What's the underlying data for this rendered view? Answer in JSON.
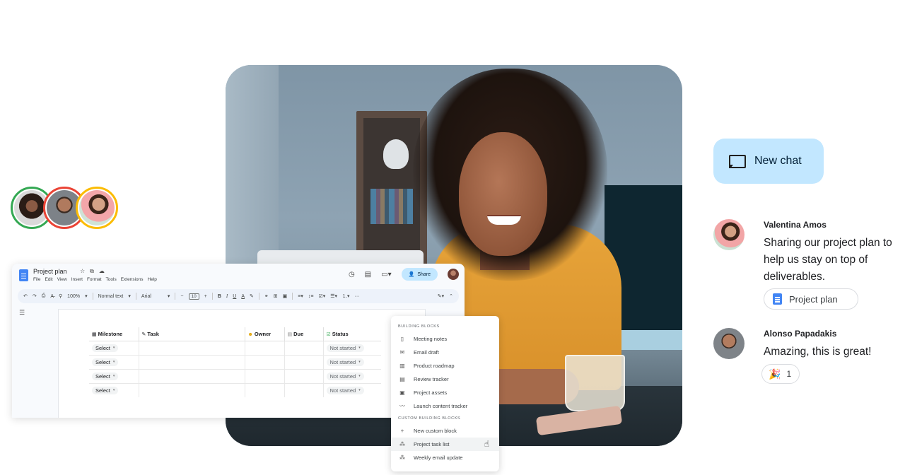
{
  "avatars": [
    {
      "name": "collaborator-1",
      "ring_color": "#34a853"
    },
    {
      "name": "collaborator-2",
      "ring_color": "#ea4335"
    },
    {
      "name": "collaborator-3",
      "ring_color": "#fbbc04"
    }
  ],
  "docs": {
    "title": "Project plan",
    "title_icons": [
      "☆",
      "⧉",
      "☁"
    ],
    "menu": [
      "File",
      "Edit",
      "View",
      "Insert",
      "Format",
      "Tools",
      "Extensions",
      "Help"
    ],
    "share_label": "Share",
    "header_icons": {
      "history": "◷",
      "comments": "▤",
      "meet": "▭▾"
    },
    "toolbar": {
      "undo": "↶",
      "redo": "↷",
      "print": "⎙",
      "spellcheck": "A̶",
      "paint_format": "⚲",
      "zoom": "100%",
      "style": "Normal text",
      "font": "Arial",
      "font_size": "10",
      "minus": "−",
      "plus": "+",
      "bold": "B",
      "italic": "I",
      "underline": "U",
      "text_color": "A",
      "highlight": "✎",
      "link": "⚭",
      "comment": "⊞",
      "image": "▣",
      "align": "≡▾",
      "line_spacing": "↕≡",
      "checklist": "☑▾",
      "bullets": "☰▾",
      "numbered": "⒈▾",
      "more": "···",
      "editing": "✎▾",
      "collapse": "⌃"
    },
    "outline_icon": "☰",
    "table": {
      "headers": [
        {
          "emoji": "▦",
          "label": "Milestone"
        },
        {
          "emoji": "✎",
          "label": "Task"
        },
        {
          "emoji": "☻",
          "label": "Owner"
        },
        {
          "emoji": "▤",
          "label": "Due"
        },
        {
          "emoji": "☑",
          "label": "Status"
        }
      ],
      "rows": [
        {
          "milestone": "Select",
          "task": "",
          "owner": "",
          "due": "",
          "status": "Not started"
        },
        {
          "milestone": "Select",
          "task": "",
          "owner": "",
          "due": "",
          "status": "Not started"
        },
        {
          "milestone": "Select",
          "task": "",
          "owner": "",
          "due": "",
          "status": "Not started"
        },
        {
          "milestone": "Select",
          "task": "",
          "owner": "",
          "due": "",
          "status": "Not started"
        }
      ]
    }
  },
  "building_blocks": {
    "section1": "Building blocks",
    "items1": [
      {
        "icon": "▯",
        "label": "Meeting notes"
      },
      {
        "icon": "✉",
        "label": "Email draft"
      },
      {
        "icon": "▥",
        "label": "Product roadmap"
      },
      {
        "icon": "▤",
        "label": "Review tracker"
      },
      {
        "icon": "▣",
        "label": "Project assets"
      },
      {
        "icon": "〰",
        "label": "Launch content tracker"
      }
    ],
    "section2": "Custom building blocks",
    "items2": [
      {
        "icon": "+",
        "label": "New custom block"
      },
      {
        "icon": "⁂",
        "label": "Project task list"
      },
      {
        "icon": "⁂",
        "label": "Weekly email update"
      }
    ],
    "hovered_item": "Project task list",
    "cursor": "☝"
  },
  "chat": {
    "new_chat_label": "New chat",
    "messages": [
      {
        "sender": "Valentina Amos",
        "text": "Sharing our project plan to help us stay on top of deliverables.",
        "attachment": "Project plan"
      },
      {
        "sender": "Alonso Papadakis",
        "text": "Amazing, this is great!",
        "reaction_emoji": "🎉",
        "reaction_count": "1"
      }
    ]
  },
  "colors": {
    "accent_blue": "#c2e7ff",
    "docs_blue": "#4285f4",
    "toolbar_bg": "#edf2fa"
  }
}
